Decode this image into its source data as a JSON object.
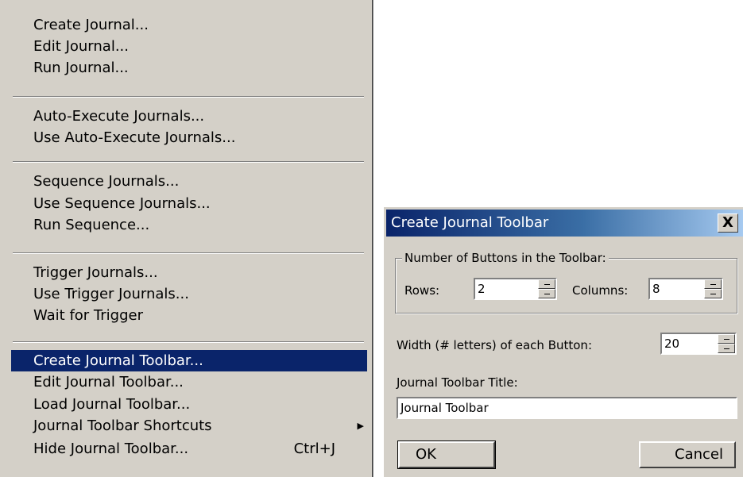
{
  "menu": {
    "groups": [
      [
        "Create Journal...",
        "Edit Journal...",
        "Run Journal..."
      ],
      [
        "Auto-Execute Journals...",
        "Use Auto-Execute Journals..."
      ],
      [
        "Sequence Journals...",
        "Use Sequence Journals...",
        "Run Sequence..."
      ],
      [
        "Trigger Journals...",
        "Use Trigger Journals...",
        "Wait for Trigger"
      ],
      [
        "Create Journal Toolbar...",
        "Edit Journal Toolbar...",
        "Load Journal Toolbar...",
        "Journal Toolbar Shortcuts",
        "Hide Journal Toolbar..."
      ]
    ],
    "selected_item": "Create Journal Toolbar...",
    "submenu_arrow": "▶",
    "hide_toolbar_shortcut": "Ctrl+J"
  },
  "dialog": {
    "title": "Create Journal Toolbar",
    "close_label": "X",
    "group_label": "Number of Buttons in the Toolbar:",
    "rows_label": "Rows:",
    "rows_value": "2",
    "columns_label": "Columns:",
    "columns_value": "8",
    "width_label": "Width (# letters) of each Button:",
    "width_value": "20",
    "title_field_label": "Journal Toolbar Title:",
    "title_field_value": "Journal Toolbar",
    "ok_label": "OK",
    "cancel_label": "Cancel"
  },
  "colors": {
    "menu_bg": "#d4d0c8",
    "selection_bg": "#0a246a",
    "titlebar_start": "#0a246a",
    "titlebar_end": "#a6caf0"
  }
}
